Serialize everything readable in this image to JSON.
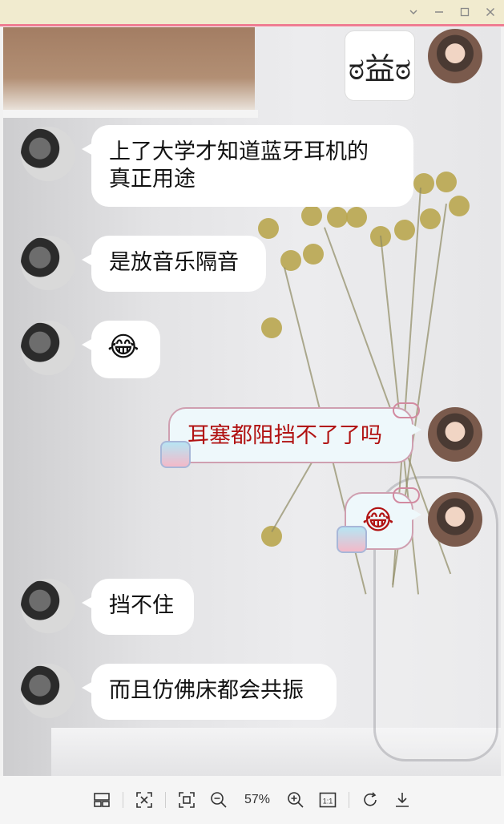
{
  "window": {
    "controls": [
      "chevron-down-icon",
      "minimize-icon",
      "maximize-icon",
      "close-icon"
    ]
  },
  "chat": {
    "messages": [
      {
        "side": "left",
        "text": "上了大学才知道蓝牙耳机的\n真正用途"
      },
      {
        "side": "left",
        "text": "是放音乐隔音"
      },
      {
        "side": "left",
        "text": "😂",
        "emoji": true
      },
      {
        "side": "right",
        "text": "耳塞都阻挡不了了吗"
      },
      {
        "side": "right",
        "text": "😂",
        "emoji": true
      },
      {
        "side": "left",
        "text": "挡不住"
      },
      {
        "side": "left",
        "text": "而且仿佛床都会共振"
      }
    ],
    "panda_face": "ಠ益ಠ"
  },
  "toolbar": {
    "zoom_label": "57%",
    "one_to_one": "1:1",
    "icons": [
      "thumbnails-icon",
      "fit-icon",
      "fullscreen-icon",
      "zoom-out-icon",
      "zoom-in-icon",
      "actual-size-icon",
      "rotate-icon",
      "download-icon"
    ]
  },
  "colors": {
    "titlebar": "#f1ebcf",
    "accent": "#ef7c92",
    "right_text": "#b11212"
  }
}
